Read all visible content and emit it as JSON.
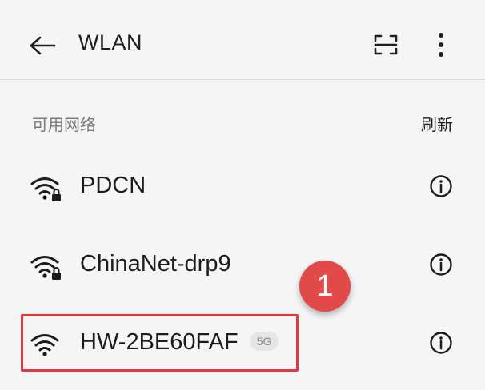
{
  "header": {
    "title": "WLAN",
    "back_icon": "arrow-left-icon",
    "scan_icon": "scan-icon",
    "more_icon": "more-vertical-icon"
  },
  "section": {
    "label": "可用网络",
    "refresh_label": "刷新"
  },
  "networks": [
    {
      "ssid": "PDCN",
      "secured": true,
      "band": "",
      "icon": "wifi-lock-icon"
    },
    {
      "ssid": "ChinaNet-drp9",
      "secured": true,
      "band": "",
      "icon": "wifi-lock-icon"
    },
    {
      "ssid": "HW-2BE60FAF",
      "secured": false,
      "band": "5G",
      "icon": "wifi-icon"
    }
  ],
  "annotation": {
    "step_number": "1",
    "color": "#e0393e"
  }
}
